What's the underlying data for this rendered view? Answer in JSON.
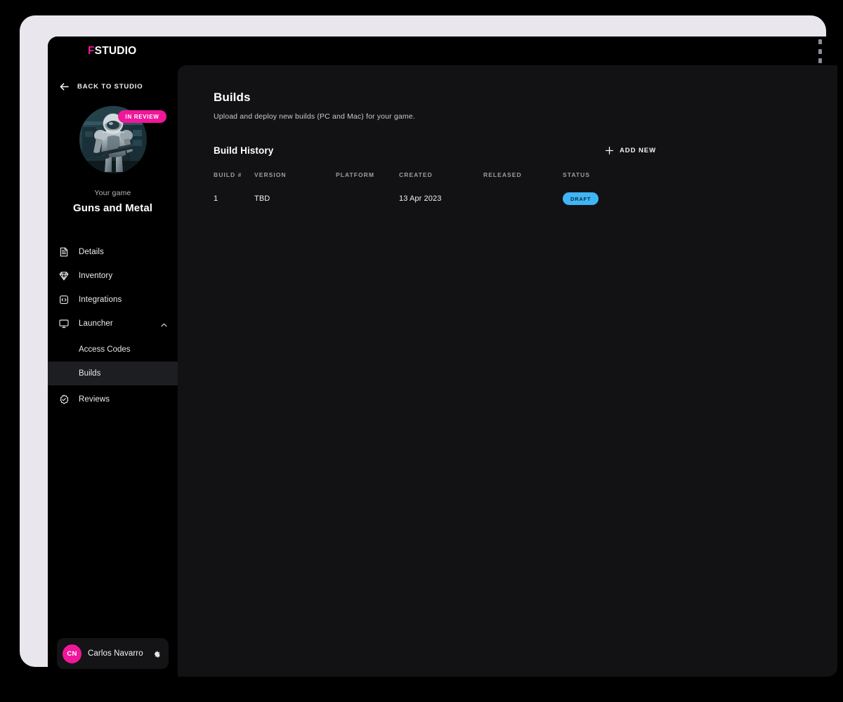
{
  "brand": {
    "logo_accent_letter": "F",
    "logo_rest": "STUDIO",
    "accent_pink": "#f0179b",
    "accent_blue": "#3fb5f5"
  },
  "sidebar": {
    "back_link": {
      "label": "BACK TO STUDIO",
      "icon": "arrow-left-icon"
    },
    "game": {
      "badge": "IN REVIEW",
      "eyebrow": "Your game",
      "title": "Guns and Metal",
      "thumbnail_alt": "armored soldier holding rifle"
    },
    "nav": [
      {
        "label": "Details",
        "icon": "document-icon",
        "active": false
      },
      {
        "label": "Inventory",
        "icon": "gem-icon",
        "active": false
      },
      {
        "label": "Integrations",
        "icon": "code-square-icon",
        "active": false
      },
      {
        "label": "Launcher",
        "icon": "monitor-icon",
        "active": false,
        "expanded": true,
        "chevron": "chevron-up-icon"
      }
    ],
    "launcher_children": [
      {
        "label": "Access Codes",
        "active": false
      },
      {
        "label": "Builds",
        "active": true
      }
    ],
    "nav_after": [
      {
        "label": "Reviews",
        "icon": "badge-check-icon",
        "active": false
      }
    ],
    "user": {
      "initials": "CN",
      "name": "Carlos Navarro",
      "settings_icon": "gear-icon"
    }
  },
  "main": {
    "title": "Builds",
    "subtitle": "Upload and deploy new builds (PC and Mac) for your game.",
    "section": {
      "title": "Build History",
      "add_new_label": "ADD NEW",
      "add_new_icon": "plus-icon"
    },
    "table": {
      "columns": [
        "BUILD #",
        "VERSION",
        "PLATFORM",
        "CREATED",
        "RELEASED",
        "STATUS"
      ],
      "rows": [
        {
          "build": "1",
          "version": "TBD",
          "platform": "",
          "created": "13 Apr 2023",
          "released": "",
          "status": "DRAFT"
        }
      ]
    }
  }
}
